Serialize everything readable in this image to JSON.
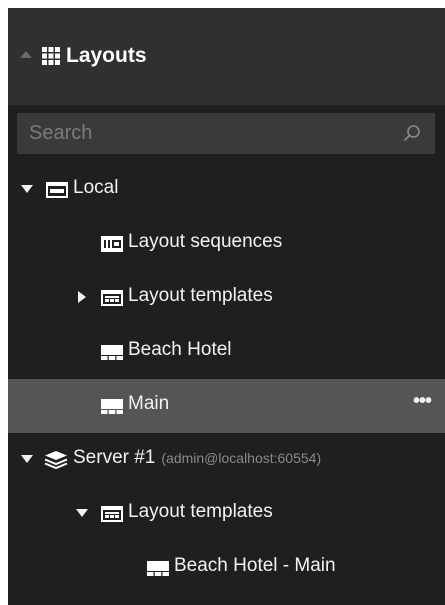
{
  "header": {
    "title": "Layouts"
  },
  "search": {
    "placeholder": "Search",
    "value": ""
  },
  "tree": {
    "local": {
      "label": "Local",
      "expanded": true
    },
    "local_layout_sequences": {
      "label": "Layout sequences"
    },
    "local_layout_templates": {
      "label": "Layout templates",
      "expanded": false
    },
    "local_beach_hotel": {
      "label": "Beach Hotel"
    },
    "local_main": {
      "label": "Main",
      "selected": true,
      "more_label": "•••"
    },
    "server": {
      "label": "Server #1",
      "connection": "(admin@localhost:60554)",
      "expanded": true
    },
    "server_layout_templates": {
      "label": "Layout templates",
      "expanded": true
    },
    "server_beach_hotel_main": {
      "label": "Beach Hotel - Main"
    }
  },
  "colors": {
    "panel_bg": "#1f1f1f",
    "header_bg": "#303030",
    "search_bg": "#3a3a3a",
    "selected_row_bg": "#555555",
    "text": "#f2f2f2",
    "muted_text": "#8a8a8a"
  },
  "icons": {
    "header": "grid-icon",
    "search": "search-icon",
    "local": "local-computer-icon",
    "layout_sequences": "layout-sequence-icon",
    "layout_templates": "layout-template-icon",
    "layout": "layout-icon",
    "server": "server-stack-icon"
  }
}
